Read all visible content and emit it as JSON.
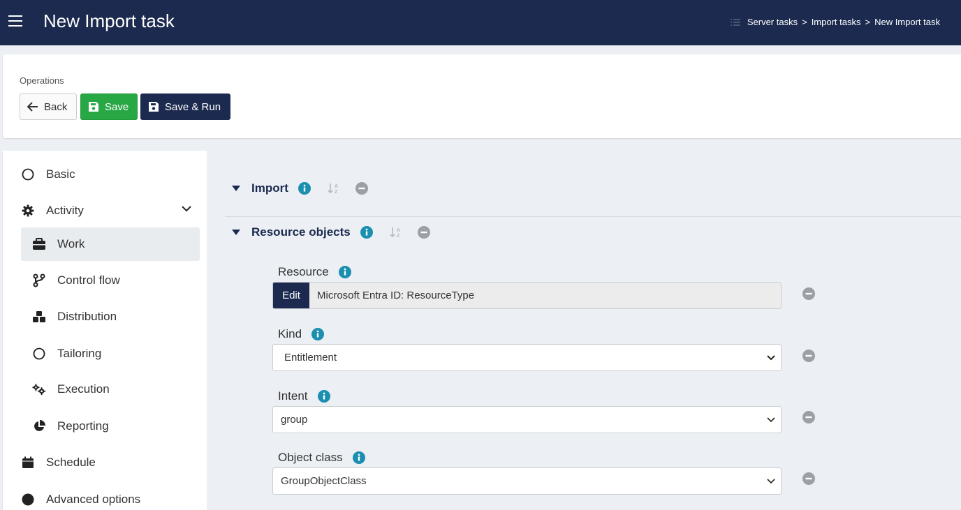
{
  "header": {
    "title": "New Import task",
    "breadcrumbs": [
      "Server tasks",
      "Import tasks",
      "New Import task"
    ],
    "separator": ">"
  },
  "operations": {
    "label": "Operations",
    "back_label": "Back",
    "save_label": "Save",
    "save_run_label": "Save & Run"
  },
  "sidebar": {
    "items": [
      {
        "label": "Basic",
        "icon": "circle-outline-icon"
      },
      {
        "label": "Activity",
        "icon": "gear-icon"
      },
      {
        "label": "Work",
        "icon": "briefcase-icon"
      },
      {
        "label": "Control flow",
        "icon": "code-branch-icon"
      },
      {
        "label": "Distribution",
        "icon": "cubes-icon"
      },
      {
        "label": "Tailoring",
        "icon": "circle-outline-icon"
      },
      {
        "label": "Execution",
        "icon": "cogs-icon"
      },
      {
        "label": "Reporting",
        "icon": "pie-chart-icon"
      },
      {
        "label": "Schedule",
        "icon": "calendar-icon"
      },
      {
        "label": "Advanced options",
        "icon": "circle-filled-icon"
      }
    ]
  },
  "sections": {
    "import": {
      "title": "Import"
    },
    "resource_objects": {
      "title": "Resource objects"
    }
  },
  "fields": {
    "resource": {
      "label": "Resource",
      "edit_label": "Edit",
      "value": "Microsoft Entra ID: ResourceType"
    },
    "kind": {
      "label": "Kind",
      "value": "Entitlement"
    },
    "intent": {
      "label": "Intent",
      "value": "group"
    },
    "object_class": {
      "label": "Object class",
      "value": "GroupObjectClass"
    }
  },
  "colors": {
    "primary": "#1b2a4e",
    "success": "#28a745",
    "info": "#1b8fb0",
    "muted": "#9aa0a6"
  }
}
